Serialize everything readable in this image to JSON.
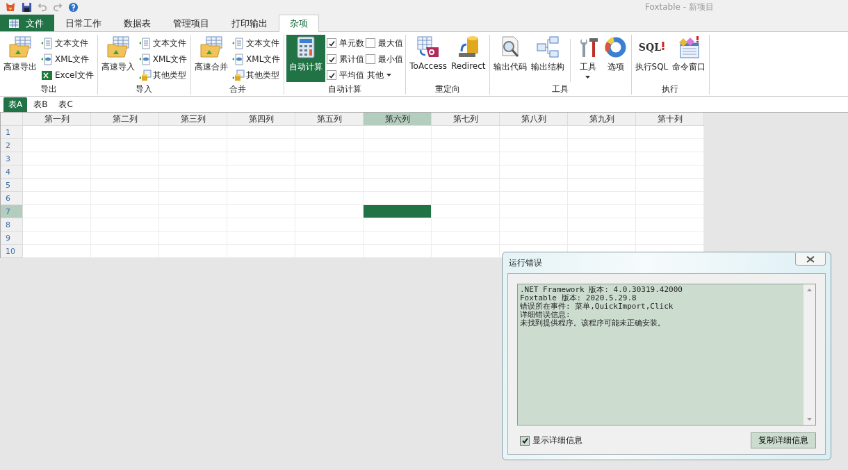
{
  "window": {
    "title": "Foxtable - 新项目"
  },
  "ribbon_tabs": [
    {
      "label": "文件",
      "kind": "file",
      "selected": false
    },
    {
      "label": "日常工作",
      "kind": "tab",
      "selected": false
    },
    {
      "label": "数据表",
      "kind": "tab",
      "selected": false
    },
    {
      "label": "管理项目",
      "kind": "tab",
      "selected": false
    },
    {
      "label": "打印输出",
      "kind": "tab",
      "selected": false
    },
    {
      "label": "杂项",
      "kind": "tab",
      "selected": true
    }
  ],
  "ribbon_groups": [
    {
      "label": "导出",
      "columns": [
        {
          "kind": "large",
          "label": "高速导出"
        },
        {
          "kind": "stack",
          "items": [
            {
              "kind": "small",
              "label": "文本文件"
            },
            {
              "kind": "small",
              "label": "XML文件"
            },
            {
              "kind": "small",
              "label": "Excel文件"
            }
          ]
        }
      ]
    },
    {
      "label": "导入",
      "columns": [
        {
          "kind": "large",
          "label": "高速导入"
        },
        {
          "kind": "stack",
          "items": [
            {
              "kind": "small",
              "label": "文本文件"
            },
            {
              "kind": "small",
              "label": "XML文件"
            },
            {
              "kind": "small",
              "label": "其他类型"
            }
          ]
        }
      ]
    },
    {
      "label": "合并",
      "columns": [
        {
          "kind": "large",
          "label": "高速合并"
        },
        {
          "kind": "stack",
          "items": [
            {
              "kind": "small",
              "label": "文本文件"
            },
            {
              "kind": "small",
              "label": "XML文件"
            },
            {
              "kind": "small",
              "label": "其他类型"
            }
          ]
        }
      ]
    },
    {
      "label": "自动计算",
      "columns": [
        {
          "kind": "large",
          "label": "自动计算",
          "selected": true
        },
        {
          "kind": "stack",
          "items": [
            {
              "kind": "check",
              "label": "单元数",
              "checked": true
            },
            {
              "kind": "check",
              "label": "累计值",
              "checked": true
            },
            {
              "kind": "check",
              "label": "平均值",
              "checked": true
            }
          ]
        },
        {
          "kind": "stack",
          "items": [
            {
              "kind": "check",
              "label": "最大值",
              "checked": false
            },
            {
              "kind": "check",
              "label": "最小值",
              "checked": false
            },
            {
              "kind": "dropdown",
              "label": "其他"
            }
          ]
        }
      ]
    },
    {
      "label": "重定向",
      "columns": [
        {
          "kind": "large",
          "label": "ToAccess"
        },
        {
          "kind": "large",
          "label": "Redirect"
        }
      ]
    },
    {
      "label": "工具",
      "columns": [
        {
          "kind": "large",
          "label": "输出代码"
        },
        {
          "kind": "large",
          "label": "输出结构"
        },
        {
          "kind": "separator"
        },
        {
          "kind": "large_dropdown",
          "label": "工具"
        },
        {
          "kind": "large",
          "label": "选项"
        }
      ]
    },
    {
      "label": "执行",
      "columns": [
        {
          "kind": "large",
          "label": "执行SQL",
          "icon_text": "SQL"
        },
        {
          "kind": "large",
          "label": "命令窗口"
        }
      ]
    }
  ],
  "sheet_tabs": [
    {
      "label": "表A",
      "selected": true
    },
    {
      "label": "表B",
      "selected": false
    },
    {
      "label": "表C",
      "selected": false
    }
  ],
  "grid": {
    "columns": [
      {
        "label": "第一列",
        "selected": false
      },
      {
        "label": "第二列",
        "selected": false
      },
      {
        "label": "第三列",
        "selected": false
      },
      {
        "label": "第四列",
        "selected": false
      },
      {
        "label": "第五列",
        "selected": false
      },
      {
        "label": "第六列",
        "selected": true
      },
      {
        "label": "第七列",
        "selected": false
      },
      {
        "label": "第八列",
        "selected": false
      },
      {
        "label": "第九列",
        "selected": false
      },
      {
        "label": "第十列",
        "selected": false
      }
    ],
    "rows": [
      {
        "label": "1",
        "selected": false
      },
      {
        "label": "2",
        "selected": false
      },
      {
        "label": "3",
        "selected": false
      },
      {
        "label": "4",
        "selected": false
      },
      {
        "label": "5",
        "selected": false
      },
      {
        "label": "6",
        "selected": false
      },
      {
        "label": "7",
        "selected": true
      },
      {
        "label": "8",
        "selected": false
      },
      {
        "label": "9",
        "selected": false
      },
      {
        "label": "10",
        "selected": false
      }
    ]
  },
  "dialog": {
    "title": "运行错误",
    "details": [
      ".NET Framework 版本: 4.0.30319.42000",
      "Foxtable 版本: 2020.5.29.8",
      "错误所在事件: 菜单,QuickImport,Click",
      "详细错误信息:",
      "未找到提供程序。该程序可能未正确安装。"
    ],
    "show_details": {
      "label": "显示详细信息",
      "checked": true
    },
    "copy_button": "复制详细信息"
  }
}
